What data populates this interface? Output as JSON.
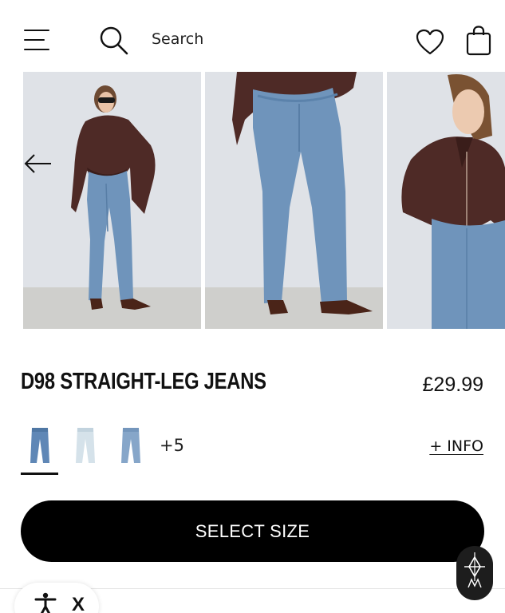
{
  "header": {
    "search_placeholder": "Search",
    "menu_icon": "hamburger-menu-icon",
    "search_icon": "search-icon",
    "wishlist_icon": "heart-icon",
    "bag_icon": "shopping-bag-icon"
  },
  "gallery": {
    "prev_icon": "arrow-left-icon",
    "images": [
      "model-full-body-front",
      "jeans-legs-closeup",
      "model-torso-side"
    ]
  },
  "product": {
    "title": "D98 STRAIGHT-LEG JEANS",
    "price": "£29.99",
    "swatches": [
      "mid-blue",
      "light-wash",
      "blue"
    ],
    "more_colors": "+5",
    "info_link": "+ INFO",
    "select_size": "SELECT SIZE"
  },
  "accessibility": {
    "close_label": "X",
    "icon": "accessibility-icon"
  },
  "colors": {
    "primary": "#000000",
    "background": "#ffffff",
    "denim": "#6f94bb",
    "leather": "#4e2a26"
  }
}
